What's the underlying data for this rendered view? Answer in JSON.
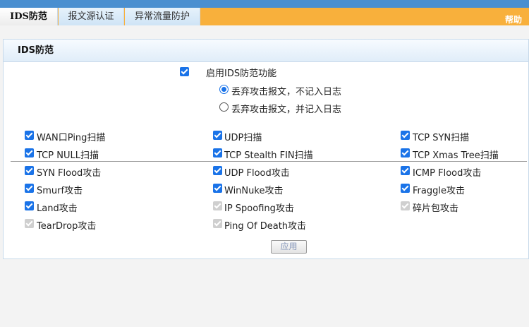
{
  "tabs": [
    {
      "label": "IDS防范",
      "active": true
    },
    {
      "label": "报文源认证",
      "active": false
    },
    {
      "label": "异常流量防护",
      "active": false
    }
  ],
  "help_label": "帮助",
  "panel": {
    "title": "IDS防范"
  },
  "enable": {
    "label": "启用IDS防范功能",
    "checked": true
  },
  "radios": [
    {
      "label": "丢弃攻击报文，不记入日志",
      "selected": true
    },
    {
      "label": "丢弃攻击报文，并记入日志",
      "selected": false
    }
  ],
  "attacks": [
    [
      {
        "label": "WAN口Ping扫描",
        "checked": true,
        "disabled": false
      },
      {
        "label": "UDP扫描",
        "checked": true,
        "disabled": false
      },
      {
        "label": "TCP SYN扫描",
        "checked": true,
        "disabled": false
      }
    ],
    [
      {
        "label": "TCP NULL扫描",
        "checked": true,
        "disabled": false
      },
      {
        "label": "TCP Stealth FIN扫描",
        "checked": true,
        "disabled": false
      },
      {
        "label": "TCP Xmas Tree扫描",
        "checked": true,
        "disabled": false
      }
    ],
    [
      {
        "label": "SYN Flood攻击",
        "checked": true,
        "disabled": false
      },
      {
        "label": "UDP Flood攻击",
        "checked": true,
        "disabled": false
      },
      {
        "label": "ICMP Flood攻击",
        "checked": true,
        "disabled": false
      }
    ],
    [
      {
        "label": "Smurf攻击",
        "checked": true,
        "disabled": false
      },
      {
        "label": "WinNuke攻击",
        "checked": true,
        "disabled": false
      },
      {
        "label": "Fraggle攻击",
        "checked": true,
        "disabled": false
      }
    ],
    [
      {
        "label": "Land攻击",
        "checked": true,
        "disabled": false
      },
      {
        "label": "IP Spoofing攻击",
        "checked": true,
        "disabled": true
      },
      {
        "label": "碎片包攻击",
        "checked": true,
        "disabled": true
      }
    ],
    [
      {
        "label": "TearDrop攻击",
        "checked": true,
        "disabled": true
      },
      {
        "label": "Ping Of Death攻击",
        "checked": true,
        "disabled": true
      }
    ]
  ],
  "apply_label": "应用",
  "colors": {
    "accent": "#1a73e8",
    "tabbar": "#f8b03c",
    "topstrip": "#4a8fd0"
  }
}
